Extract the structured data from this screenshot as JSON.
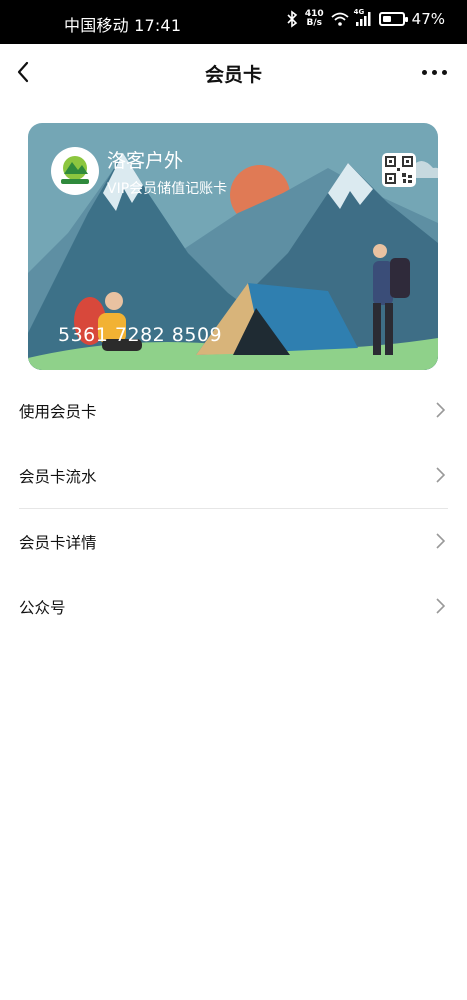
{
  "status_bar": {
    "carrier_time": "中国移动 17:41",
    "net_speed_value": "410",
    "net_speed_unit": "B/s",
    "network_type": "4G",
    "battery_percent": "47%",
    "battery_level": 0.47
  },
  "nav": {
    "back_icon": "chevron-left-icon",
    "title": "会员卡",
    "more_icon": "more-dots-icon"
  },
  "card": {
    "brand_name": "洛客户外",
    "subtitle": "VIP会员储值记账卡",
    "card_number": "5361 7282 8509",
    "logo_text": "洛客户外",
    "qr_icon": "qr-code-icon",
    "colors": {
      "sky": "#6fa3b3",
      "mountain": "#3b6f86",
      "snow": "#d9e9ee",
      "sun": "#e07a55",
      "grass": "#8fd18a",
      "tent": "#2f7fb0"
    }
  },
  "menu": {
    "items": [
      {
        "label": "使用会员卡"
      },
      {
        "label": "会员卡流水"
      },
      {
        "label": "会员卡详情"
      },
      {
        "label": "公众号"
      }
    ]
  }
}
